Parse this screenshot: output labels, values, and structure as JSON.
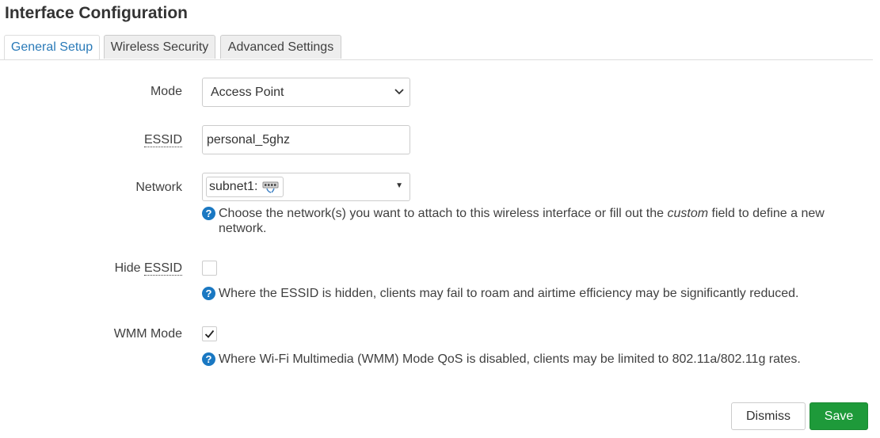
{
  "dialog": {
    "title": "Interface Configuration"
  },
  "tabs": [
    {
      "label": "General Setup",
      "active": true
    },
    {
      "label": "Wireless Security",
      "active": false
    },
    {
      "label": "Advanced Settings",
      "active": false
    }
  ],
  "fields": {
    "mode": {
      "label": "Mode",
      "value": "Access Point"
    },
    "essid": {
      "label": "ESSID",
      "value": "personal_5ghz"
    },
    "network": {
      "label": "Network",
      "value": "subnet1:",
      "icon": "network-ports-icon",
      "help_before": "Choose the network(s) you want to attach to this wireless interface or fill out the ",
      "help_em": "custom",
      "help_after": " field to define a new",
      "help_line2": "network."
    },
    "hide_essid": {
      "label_prefix": "Hide ",
      "label_abbr": "ESSID",
      "checked": false,
      "help": "Where the ESSID is hidden, clients may fail to roam and airtime efficiency may be significantly reduced."
    },
    "wmm_mode": {
      "label": "WMM Mode",
      "checked": true,
      "help": "Where Wi-Fi Multimedia (WMM) Mode QoS is disabled, clients may be limited to 802.11a/802.11g rates."
    }
  },
  "footer": {
    "dismiss_label": "Dismiss",
    "save_label": "Save"
  },
  "colors": {
    "accent": "#2a7ab8",
    "save": "#1e9a3a",
    "help_icon": "#1a78c2"
  },
  "help_icon_glyph": "?"
}
